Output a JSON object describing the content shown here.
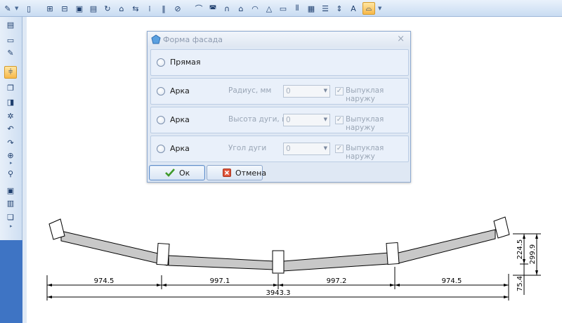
{
  "dialog": {
    "title": "Форма фасада",
    "close_glyph": "×",
    "options": [
      {
        "label": "Прямая",
        "param_label": null
      },
      {
        "label": "Арка",
        "param_label": "Радиус, мм",
        "value": "0",
        "checkbox_label": "Выпуклая наружу",
        "checked": true
      },
      {
        "label": "Арка",
        "param_label": "Высота дуги, мм",
        "value": "0",
        "checkbox_label": "Выпуклая наружу",
        "checked": true
      },
      {
        "label": "Арка",
        "param_label": "Угол дуги",
        "value": "0",
        "checkbox_label": "Выпуклая наружу",
        "checked": true
      }
    ],
    "ok_label": "Ок",
    "cancel_label": "Отмена"
  },
  "drawing": {
    "dims": {
      "seg1": "974.5",
      "seg2": "997.1",
      "seg3": "997.2",
      "seg4": "974.5",
      "total": "3943.3",
      "h1": "224.5",
      "h2": "299.9",
      "h3": "75.4"
    }
  },
  "colors": {
    "accent": "#f7b84a",
    "toolbar": "#c9dcf2",
    "panel_fill": "#c8c8c8"
  },
  "icons": {
    "ok": "checkmark-icon",
    "cancel": "cancel-icon",
    "dialog": "facade-icon"
  }
}
